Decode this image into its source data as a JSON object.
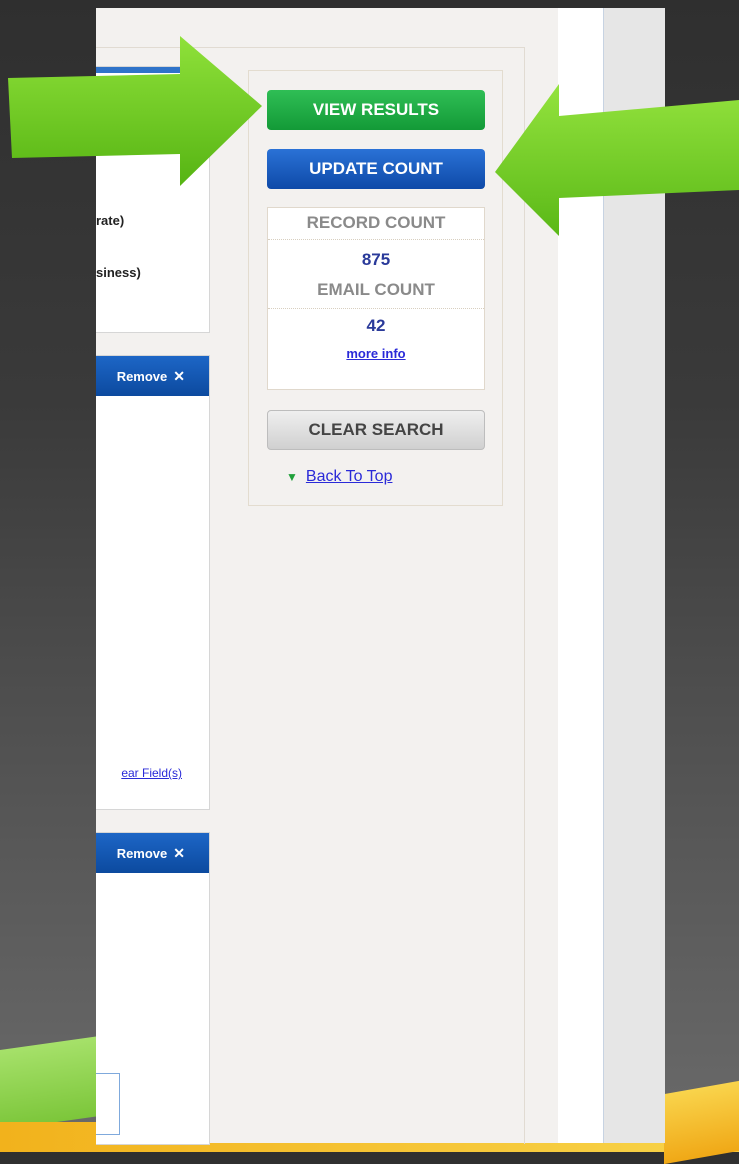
{
  "sidebar": {
    "view_results": "VIEW RESULTS",
    "update_count": "UPDATE COUNT",
    "record_count_label": "RECORD COUNT",
    "record_count_value": "875",
    "email_count_label": "EMAIL COUNT",
    "email_count_value": "42",
    "more_info": "more info",
    "clear_search": "CLEAR SEARCH",
    "back_to_top": "Back To Top"
  },
  "left_panels": {
    "panel1_line1": "rate)",
    "panel1_line2": "siness)",
    "remove_label": "Remove",
    "remove_x": "✕",
    "clear_fields": "ear Field(s)"
  },
  "colors": {
    "view_results": "#139a37",
    "update_count": "#0e4aa8",
    "arrow_green": "#7bd11f",
    "count_value": "#2a3a9a"
  },
  "icons": {
    "back_to_top": "up-arrow-icon",
    "remove": "close-icon",
    "callout": "green-arrow"
  }
}
